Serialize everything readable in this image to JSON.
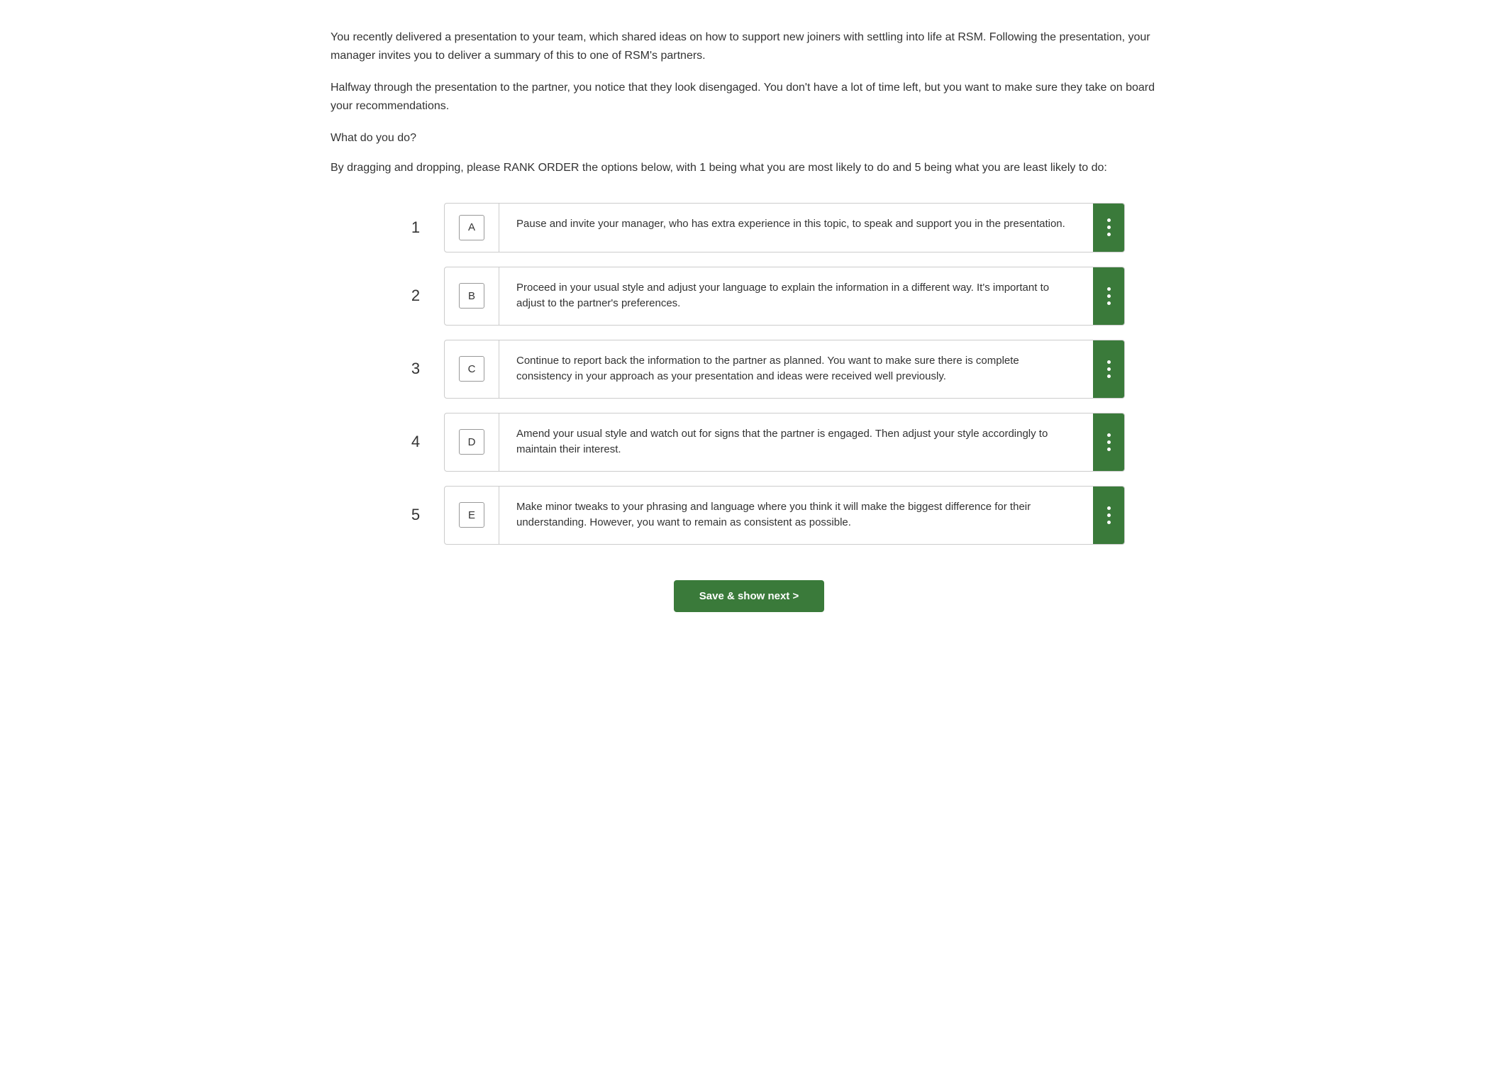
{
  "intro": {
    "paragraph1": "You recently delivered a presentation to your team, which shared ideas on how to support new joiners with settling into life at RSM. Following the presentation, your manager invites you to deliver a summary of this to one of RSM's partners.",
    "paragraph2": "Halfway through the presentation to the partner, you notice that they look disengaged. You don't have a lot of time left, but you want to make sure they take on board your recommendations.",
    "question": "What do you do?",
    "instruction": "By dragging and dropping, please RANK ORDER the options below, with 1 being what you are most likely to do and 5 being what you are least likely to do:"
  },
  "options": [
    {
      "rank": "1",
      "letter": "A",
      "text": "Pause and invite your manager, who has extra experience in this topic, to speak and support you in the presentation."
    },
    {
      "rank": "2",
      "letter": "B",
      "text": "Proceed in your usual style and adjust your language to explain the information in a different way. It's important to adjust to the partner's preferences."
    },
    {
      "rank": "3",
      "letter": "C",
      "text": "Continue to report back the information to the partner as planned. You want to make sure there is complete consistency in your approach as your presentation and ideas were received well previously."
    },
    {
      "rank": "4",
      "letter": "D",
      "text": "Amend your usual style and watch out for signs that the partner is engaged. Then adjust your style accordingly to maintain their interest."
    },
    {
      "rank": "5",
      "letter": "E",
      "text": "Make minor tweaks to your phrasing and language where you think it will make the biggest difference for their understanding. However, you want to remain as consistent as possible."
    }
  ],
  "button": {
    "label": "Save & show next >"
  }
}
